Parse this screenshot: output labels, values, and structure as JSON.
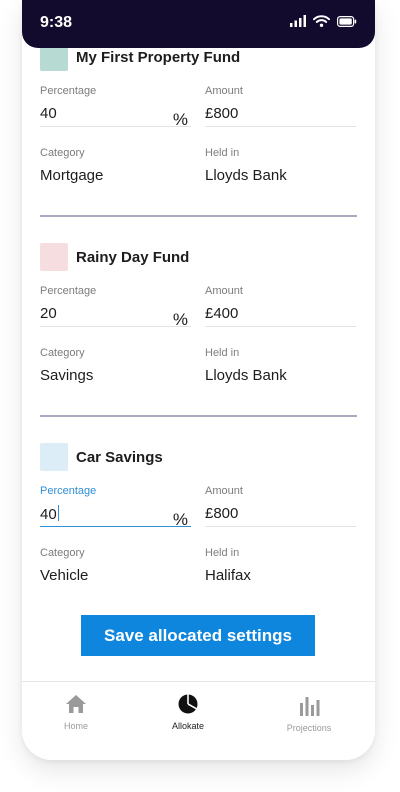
{
  "status_bar": {
    "time": "9:38"
  },
  "funds": [
    {
      "name": "My First Property Fund",
      "swatch_color": "#b7dad3",
      "percentage_label": "Percentage",
      "percentage_value": "40",
      "percent_sign": "%",
      "amount_label": "Amount",
      "amount_value": "£800",
      "category_label": "Category",
      "category_value": "Mortgage",
      "held_in_label": "Held in",
      "held_in_value": "Lloyds Bank"
    },
    {
      "name": "Rainy Day Fund",
      "swatch_color": "#f5dde0",
      "percentage_label": "Percentage",
      "percentage_value": "20",
      "percent_sign": "%",
      "amount_label": "Amount",
      "amount_value": "£400",
      "category_label": "Category",
      "category_value": "Savings",
      "held_in_label": "Held in",
      "held_in_value": "Lloyds Bank"
    },
    {
      "name": "Car Savings",
      "swatch_color": "#dcedf8",
      "percentage_label": "Percentage",
      "percentage_value": "40",
      "percent_sign": "%",
      "amount_label": "Amount",
      "amount_value": "£800",
      "category_label": "Category",
      "category_value": "Vehicle",
      "held_in_label": "Held in",
      "held_in_value": "Halifax"
    }
  ],
  "save_button": {
    "label": "Save allocated settings",
    "color": "#0f86dd"
  },
  "bottom_nav": {
    "items": [
      {
        "label": "Home",
        "icon": "home-icon"
      },
      {
        "label": "Allokate",
        "icon": "pie-chart-icon",
        "active": true
      },
      {
        "label": "Projections",
        "icon": "bar-chart-icon"
      }
    ]
  },
  "colors": {
    "status_bar": "#130b2d",
    "divider": "#a9aac0",
    "focus": "#2f8fd6"
  }
}
